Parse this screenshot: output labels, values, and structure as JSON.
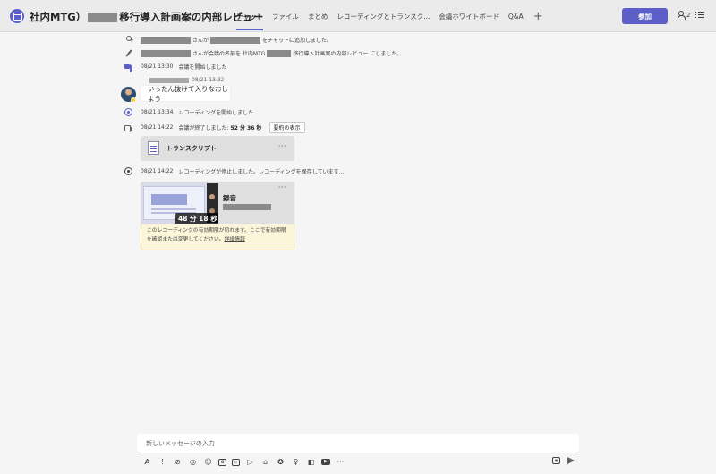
{
  "header": {
    "title_prefix": "社内MTG）",
    "title_suffix": "移行導入計画案の内部レビュー",
    "tabs": [
      "チャット",
      "ファイル",
      "まとめ",
      "レコーディングとトランスク...",
      "会議ホワイトボード",
      "Q&A"
    ],
    "add_tab": "+",
    "join_label": "参加",
    "participant_count": "2"
  },
  "events": {
    "added": "さんが",
    "added_suffix": "をチャットに追加しました。",
    "renamed": "さんが会議の名前を 社内MTG",
    "renamed_suffix": "移行導入計画案の内部レビュー にしました。",
    "meeting_start_time": "08/21 13:30",
    "meeting_start_text": "会議を開始しました",
    "msg_time": "08/21 13:32",
    "msg_text": "いったん抜けて入りなおしよう",
    "rec_start_time": "08/21 13:34",
    "rec_start_text": "レコーディングを開始しました",
    "meeting_end_time": "08/21 14:22",
    "meeting_end_text": "会議が終了しました:",
    "meeting_duration": "52 分 36 秒",
    "summary_button": "要約の表示",
    "transcript_label": "トランスクリプト",
    "rec_stop_time": "08/21 14:22",
    "rec_stop_text": "レコーディングが停止しました。レコーディングを保存しています...",
    "recording_duration": "48 分 18 秒",
    "recording_title": "録音",
    "more": "···",
    "notice_text_1": "このレコーディングの有効期限が切れます。",
    "notice_link_here": "ここ",
    "notice_text_2": "で有効期限を確認または変更してください。",
    "notice_link_details": "詳細情報"
  },
  "compose": {
    "placeholder": "新しいメッセージの入力",
    "toolbar_more": "···"
  },
  "colors": {
    "accent": "#5b5fc7",
    "background": "#f5f5f5",
    "notice": "#fbf6d9"
  }
}
